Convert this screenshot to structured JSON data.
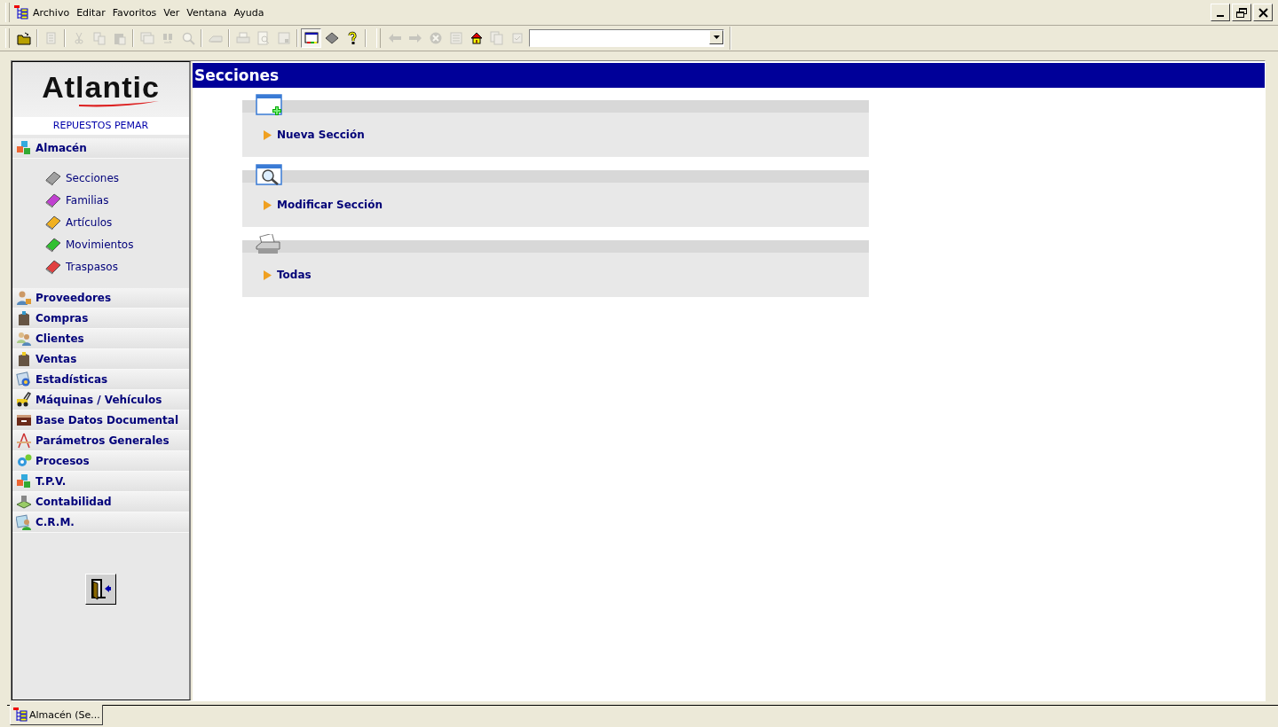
{
  "menu": [
    {
      "label": "Archivo"
    },
    {
      "label": "Editar"
    },
    {
      "label": "Favoritos"
    },
    {
      "label": "Ver"
    },
    {
      "label": "Ventana"
    },
    {
      "label": "Ayuda"
    }
  ],
  "toolbar": {
    "buttons": [
      {
        "disabled": false,
        "pressed": false
      },
      {
        "disabled": true,
        "pressed": false
      },
      {
        "disabled": true,
        "pressed": false
      },
      {
        "disabled": true,
        "pressed": false
      },
      {
        "disabled": true,
        "pressed": false
      },
      {
        "disabled": true,
        "pressed": false
      },
      {
        "disabled": true,
        "pressed": false
      },
      {
        "disabled": true,
        "pressed": false
      },
      {
        "disabled": true,
        "pressed": false
      },
      {
        "disabled": true,
        "pressed": false
      },
      {
        "disabled": true,
        "pressed": false
      },
      {
        "disabled": true,
        "pressed": false
      },
      {
        "disabled": false,
        "pressed": true
      },
      {
        "disabled": false,
        "pressed": false
      },
      {
        "disabled": false,
        "pressed": false
      },
      {
        "disabled": true,
        "pressed": false
      },
      {
        "disabled": true,
        "pressed": false
      },
      {
        "disabled": true,
        "pressed": false
      },
      {
        "disabled": true,
        "pressed": false
      },
      {
        "disabled": false,
        "pressed": false
      },
      {
        "disabled": true,
        "pressed": false
      },
      {
        "disabled": true,
        "pressed": false
      }
    ]
  },
  "sidebar": {
    "logo": "Atlantic",
    "company": "REPUESTOS PEMAR",
    "sections": [
      {
        "label": "Almacén",
        "children": [
          {
            "label": "Secciones",
            "color": "#a0a0a0"
          },
          {
            "label": "Familias",
            "color": "#c040d0"
          },
          {
            "label": "Artículos",
            "color": "#f0b020"
          },
          {
            "label": "Movimientos",
            "color": "#30c030"
          },
          {
            "label": "Traspasos",
            "color": "#e04040"
          }
        ]
      },
      {
        "label": "Proveedores"
      },
      {
        "label": "Compras"
      },
      {
        "label": "Clientes"
      },
      {
        "label": "Ventas"
      },
      {
        "label": "Estadísticas"
      },
      {
        "label": "Máquinas / Vehículos"
      },
      {
        "label": "Base Datos Documental"
      },
      {
        "label": "Parámetros Generales"
      },
      {
        "label": "Procesos"
      },
      {
        "label": "T.P.V."
      },
      {
        "label": "Contabilidad"
      },
      {
        "label": "C.R.M."
      }
    ]
  },
  "content": {
    "title": "Secciones",
    "actions": [
      {
        "label": "Nueva Sección"
      },
      {
        "label": "Modificar Sección"
      },
      {
        "label": "Todas"
      }
    ]
  },
  "taskbar": {
    "tabs": [
      {
        "label": "Almacén (Se...",
        "selected": true
      }
    ]
  }
}
